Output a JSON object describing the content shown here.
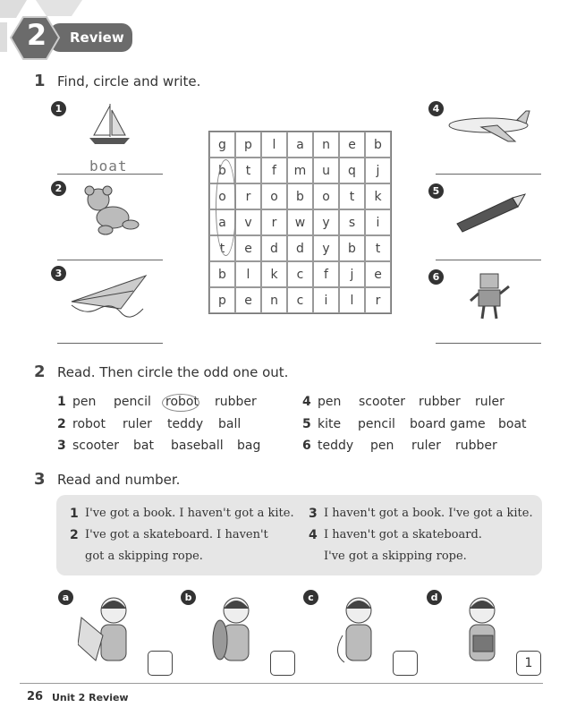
{
  "header": {
    "unit_number": "2",
    "title": "Review"
  },
  "exercise1": {
    "number": "1",
    "instruction": "Find, circle and write.",
    "items": [
      {
        "num": "1",
        "picture": "sailboat",
        "answer": "boat"
      },
      {
        "num": "2",
        "picture": "teddy-bear",
        "answer": ""
      },
      {
        "num": "3",
        "picture": "kite",
        "answer": ""
      },
      {
        "num": "4",
        "picture": "plane",
        "answer": ""
      },
      {
        "num": "5",
        "picture": "pencil",
        "answer": ""
      },
      {
        "num": "6",
        "picture": "robot",
        "answer": ""
      }
    ],
    "grid": [
      [
        "g",
        "p",
        "l",
        "a",
        "n",
        "e",
        "b"
      ],
      [
        "b",
        "t",
        "f",
        "m",
        "u",
        "q",
        "j"
      ],
      [
        "o",
        "r",
        "o",
        "b",
        "o",
        "t",
        "k"
      ],
      [
        "a",
        "v",
        "r",
        "w",
        "y",
        "s",
        "i"
      ],
      [
        "t",
        "e",
        "d",
        "d",
        "y",
        "b",
        "t"
      ],
      [
        "b",
        "l",
        "k",
        "c",
        "f",
        "j",
        "e"
      ],
      [
        "p",
        "e",
        "n",
        "c",
        "i",
        "l",
        "r"
      ]
    ]
  },
  "exercise2": {
    "number": "2",
    "instruction": "Read. Then circle the odd one out.",
    "rows": [
      {
        "num": "1",
        "words": [
          "pen",
          "pencil",
          "robot",
          "rubber"
        ],
        "circled": "robot"
      },
      {
        "num": "2",
        "words": [
          "robot",
          "ruler",
          "teddy",
          "ball"
        ]
      },
      {
        "num": "3",
        "words": [
          "scooter",
          "bat",
          "baseball",
          "bag"
        ]
      },
      {
        "num": "4",
        "words": [
          "pen",
          "scooter",
          "rubber",
          "ruler"
        ]
      },
      {
        "num": "5",
        "words": [
          "kite",
          "pencil",
          "board game",
          "boat"
        ]
      },
      {
        "num": "6",
        "words": [
          "teddy",
          "pen",
          "ruler",
          "rubber"
        ]
      }
    ]
  },
  "exercise3": {
    "number": "3",
    "instruction": "Read and number.",
    "sentences": [
      {
        "num": "1",
        "lines": [
          "I've got a book. I haven't got a kite."
        ]
      },
      {
        "num": "2",
        "lines": [
          "I've got a skateboard. I haven't",
          "got a skipping rope."
        ]
      },
      {
        "num": "3",
        "lines": [
          "I haven't got a book. I've got a kite."
        ]
      },
      {
        "num": "4",
        "lines": [
          "I haven't got a skateboard.",
          "I've got a skipping rope."
        ]
      }
    ],
    "pictures": [
      {
        "letter": "a",
        "picture": "girl-with-kite",
        "answer": ""
      },
      {
        "letter": "b",
        "picture": "boy-with-skateboard",
        "answer": ""
      },
      {
        "letter": "c",
        "picture": "girl-with-skipping-rope",
        "answer": ""
      },
      {
        "letter": "d",
        "picture": "girl-with-book",
        "answer": "1"
      }
    ]
  },
  "footer": {
    "page": "26",
    "label": "Unit 2 Review"
  },
  "colors": {
    "header_gray": "#6b6b6b",
    "panel_gray": "#e6e6e6"
  }
}
